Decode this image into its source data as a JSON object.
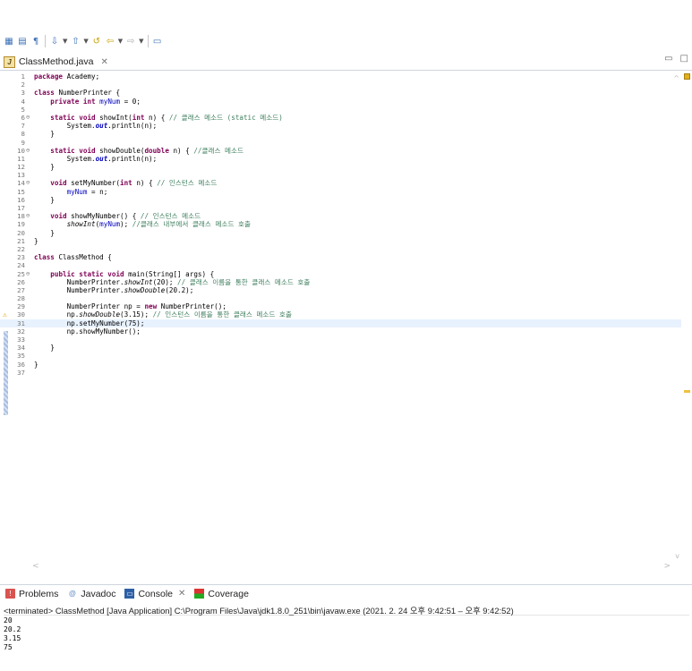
{
  "editor": {
    "tab_title": "ClassMethod.java",
    "lines": [
      {
        "n": "1",
        "t": [
          [
            "kw",
            "package"
          ],
          [
            "",
            "Academy;"
          ]
        ]
      },
      {
        "n": "2",
        "t": []
      },
      {
        "n": "3",
        "t": [
          [
            "kw",
            "class"
          ],
          [
            "",
            "NumberPrinter {"
          ]
        ]
      },
      {
        "n": "4",
        "t": [
          [
            "",
            "    "
          ],
          [
            "kw",
            "private int"
          ],
          [
            "",
            ""
          ],
          [
            "fld",
            "myNum"
          ],
          [
            "",
            "= 0;"
          ]
        ]
      },
      {
        "n": "5",
        "t": []
      },
      {
        "n": "6",
        "t": [
          [
            "",
            "    "
          ],
          [
            "kw",
            "static void"
          ],
          [
            "",
            "showInt("
          ],
          [
            "kw",
            "int"
          ],
          [
            "",
            "n) { "
          ],
          [
            "cm",
            "// 클래스 메소드 (static 메소드)"
          ]
        ],
        "fold": true
      },
      {
        "n": "7",
        "t": [
          [
            "",
            "        System."
          ],
          [
            "sfld",
            "out"
          ],
          [
            "",
            ".println(n);"
          ]
        ]
      },
      {
        "n": "8",
        "t": [
          [
            "",
            "    }"
          ]
        ]
      },
      {
        "n": "9",
        "t": []
      },
      {
        "n": "10",
        "t": [
          [
            "",
            "    "
          ],
          [
            "kw",
            "static void"
          ],
          [
            "",
            "showDouble("
          ],
          [
            "kw",
            "double"
          ],
          [
            "",
            "n) { "
          ],
          [
            "cm",
            "//클래스 메소드"
          ]
        ],
        "fold": true
      },
      {
        "n": "11",
        "t": [
          [
            "",
            "        System."
          ],
          [
            "sfld",
            "out"
          ],
          [
            "",
            ".println(n);"
          ]
        ]
      },
      {
        "n": "12",
        "t": [
          [
            "",
            "    }"
          ]
        ]
      },
      {
        "n": "13",
        "t": []
      },
      {
        "n": "14",
        "t": [
          [
            "",
            "    "
          ],
          [
            "kw",
            "void"
          ],
          [
            "",
            "setMyNumber("
          ],
          [
            "kw",
            "int"
          ],
          [
            "",
            "n) { "
          ],
          [
            "cm",
            "// 인스턴스 메소드"
          ]
        ],
        "fold": true
      },
      {
        "n": "15",
        "t": [
          [
            "",
            "        "
          ],
          [
            "fld",
            "myNum"
          ],
          [
            "",
            "= n;"
          ]
        ]
      },
      {
        "n": "16",
        "t": [
          [
            "",
            "    }"
          ]
        ]
      },
      {
        "n": "17",
        "t": []
      },
      {
        "n": "18",
        "t": [
          [
            "",
            "    "
          ],
          [
            "kw",
            "void"
          ],
          [
            "",
            "showMyNumber() { "
          ],
          [
            "cm",
            "// 인스턴스 메소드"
          ]
        ],
        "fold": true
      },
      {
        "n": "19",
        "t": [
          [
            "",
            "        "
          ],
          [
            "smeth",
            "showInt"
          ],
          [
            "",
            "("
          ],
          [
            "fld",
            "myNum"
          ],
          [
            "",
            "); "
          ],
          [
            "cm",
            "//클래스 내부에서 클래스 메소드 호출"
          ]
        ]
      },
      {
        "n": "20",
        "t": [
          [
            "",
            "    }"
          ]
        ]
      },
      {
        "n": "21",
        "t": [
          [
            "",
            "}"
          ]
        ]
      },
      {
        "n": "22",
        "t": []
      },
      {
        "n": "23",
        "t": [
          [
            "kw",
            "class"
          ],
          [
            "",
            "ClassMethod {"
          ]
        ]
      },
      {
        "n": "24",
        "t": []
      },
      {
        "n": "25",
        "t": [
          [
            "",
            "    "
          ],
          [
            "kw",
            "public static void"
          ],
          [
            "",
            "main(String[] args) {"
          ]
        ],
        "fold": true
      },
      {
        "n": "26",
        "t": [
          [
            "",
            "        NumberPrinter."
          ],
          [
            "smeth",
            "showInt"
          ],
          [
            "",
            "(20); "
          ],
          [
            "cm",
            "// 클래스 이름을 통한 클래스 메소드 호출"
          ]
        ]
      },
      {
        "n": "27",
        "t": [
          [
            "",
            "        NumberPrinter."
          ],
          [
            "smeth",
            "showDouble"
          ],
          [
            "",
            "(20.2);"
          ]
        ]
      },
      {
        "n": "28",
        "t": []
      },
      {
        "n": "29",
        "t": [
          [
            "",
            "        NumberPrinter np = "
          ],
          [
            "kw",
            "new"
          ],
          [
            "",
            "NumberPrinter();"
          ]
        ]
      },
      {
        "n": "30",
        "t": [
          [
            "",
            "        np."
          ],
          [
            "smeth",
            "showDouble"
          ],
          [
            "",
            "(3.15); "
          ],
          [
            "cm",
            "// 인스턴스 이름을 통한 클래스 메소드 호출"
          ]
        ],
        "warn": true
      },
      {
        "n": "31",
        "t": [
          [
            "",
            "        np.setMyNumber(75);"
          ]
        ],
        "current": true
      },
      {
        "n": "32",
        "t": [
          [
            "",
            "        np.showMyNumber();"
          ]
        ]
      },
      {
        "n": "33",
        "t": []
      },
      {
        "n": "34",
        "t": [
          [
            "",
            "    }"
          ]
        ]
      },
      {
        "n": "35",
        "t": []
      },
      {
        "n": "36",
        "t": [
          [
            "",
            "}"
          ]
        ]
      },
      {
        "n": "37",
        "t": []
      }
    ]
  },
  "console_tabs": {
    "problems": "Problems",
    "javadoc": "Javadoc",
    "console": "Console",
    "coverage": "Coverage"
  },
  "console": {
    "status": "<terminated> ClassMethod [Java Application] C:\\Program Files\\Java\\jdk1.8.0_251\\bin\\javaw.exe  (2021. 2. 24 오후 9:42:51 – 오후 9:42:52)",
    "output": [
      "20",
      "20.2",
      "3.15",
      "75"
    ]
  },
  "icons": {
    "tab_close": "close-icon",
    "java_file": "java-file-icon"
  }
}
